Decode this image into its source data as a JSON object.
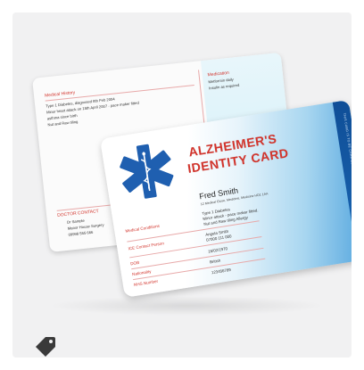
{
  "front_card": {
    "title_line_1": "ALZHEIMER'S",
    "title_line_2": "IDENTITY CARD",
    "name": "Fred Smith",
    "address": "12 Medical Close, Medicine, Medicine HO1 1AA",
    "fields": [
      {
        "label": "Medical Conditions",
        "values": [
          "Type 1 Diabetes",
          "Minor attack - pace maker fitted.",
          "Nut and Raw tiling Allergy"
        ]
      },
      {
        "label": "ICE Contact Person",
        "values": [
          "Angela Smith",
          "07000 111 000"
        ]
      },
      {
        "label": "DOB",
        "values": [
          "16/02/1970"
        ]
      },
      {
        "label": "Nationality",
        "values": [
          "British"
        ]
      },
      {
        "label": "NHS Number",
        "values": [
          "123456789"
        ]
      }
    ],
    "edge_text": "THIS CARD IS TO BE CARRIED AT ALL TIMES"
  },
  "back_card": {
    "heading": "Medical History",
    "history_lines": [
      "Type 1 Diabetes, diagnosed 8th Feb 2004",
      "Minor heart attack on 15th April 2007 - pace maker fitted",
      "asthma since birth",
      "Nut and Raw tiling"
    ],
    "medication_heading": "Medication",
    "medication_lines": [
      "Metformin daily",
      "Insulin as required"
    ],
    "doctor_heading": "DOCTOR CONTACT",
    "doctor_lines": [
      "Dr Sample",
      "Manor House Surgery",
      "09998 555 666"
    ]
  },
  "icons": {
    "tag": "price-tag-icon",
    "emblem": "star-of-life-icon"
  },
  "colors": {
    "title_red": "#d2342c",
    "star_blue": "#1f5fb0",
    "edge_blue": "#0f4e97"
  }
}
